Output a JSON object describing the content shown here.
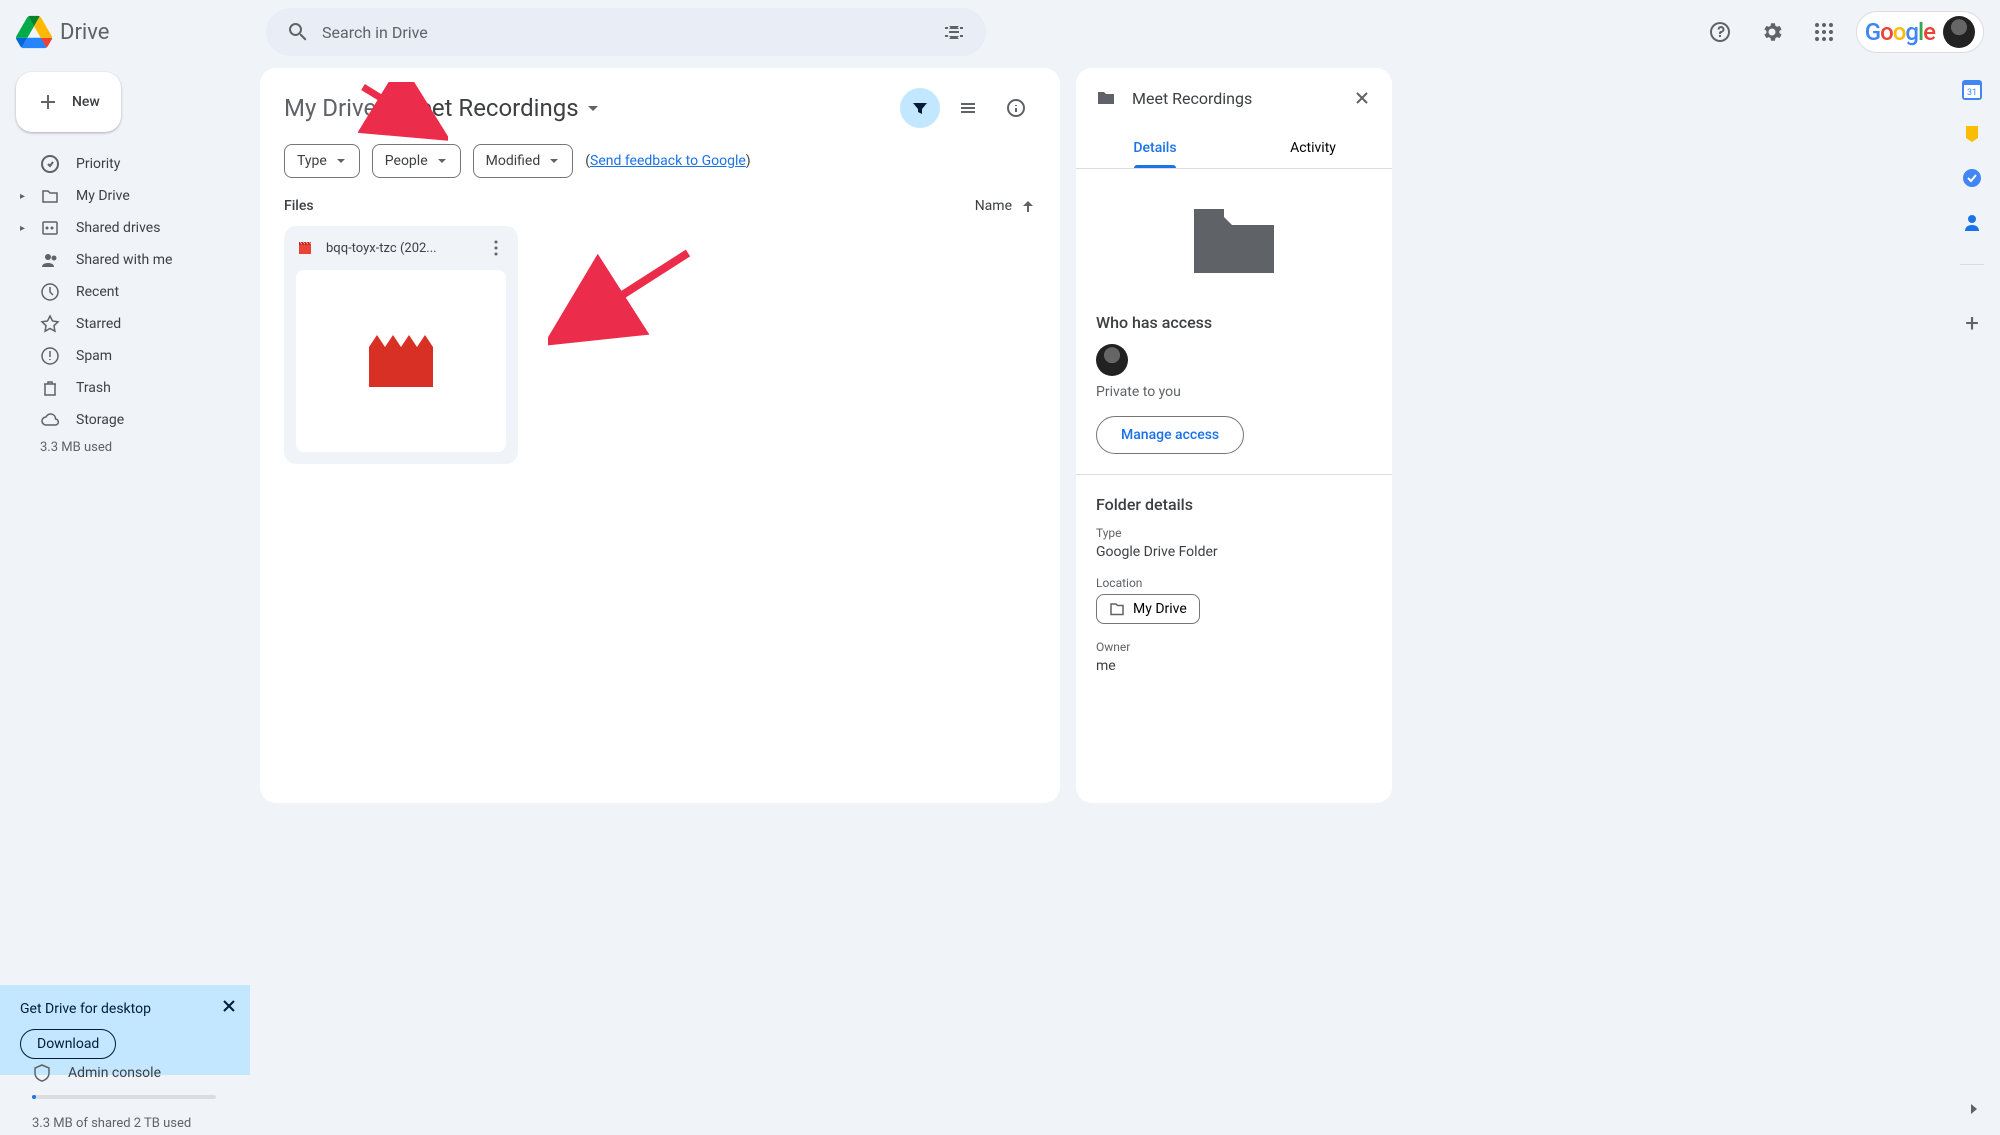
{
  "app": {
    "name": "Drive"
  },
  "search": {
    "placeholder": "Search in Drive"
  },
  "header": {
    "google_label": "Google"
  },
  "sidebar": {
    "new_label": "New",
    "items": [
      {
        "label": "Priority"
      },
      {
        "label": "My Drive"
      },
      {
        "label": "Shared drives"
      },
      {
        "label": "Shared with me"
      },
      {
        "label": "Recent"
      },
      {
        "label": "Starred"
      },
      {
        "label": "Spam"
      },
      {
        "label": "Trash"
      },
      {
        "label": "Storage"
      }
    ],
    "storage_used": "3.3 MB used",
    "promo": {
      "title": "Get Drive for desktop",
      "button": "Download"
    },
    "admin_label": "Admin console",
    "storage_summary": "3.3 MB of shared 2 TB used"
  },
  "breadcrumb": {
    "root": "My Drive",
    "current": "Meet Recordings"
  },
  "chips": {
    "type": "Type",
    "people": "People",
    "modified": "Modified"
  },
  "feedback": {
    "open": "(",
    "link": "Send feedback to Google",
    "close": ")"
  },
  "files": {
    "section_label": "Files",
    "sort_label": "Name",
    "items": [
      {
        "name": "bqq-toyx-tzc (202..."
      }
    ]
  },
  "details": {
    "title": "Meet Recordings",
    "tabs": {
      "details": "Details",
      "activity": "Activity"
    },
    "access": {
      "heading": "Who has access",
      "private": "Private to you",
      "manage": "Manage access"
    },
    "folder_details": {
      "heading": "Folder details",
      "type_label": "Type",
      "type_value": "Google Drive Folder",
      "location_label": "Location",
      "location_value": "My Drive",
      "owner_label": "Owner",
      "owner_value": "me"
    }
  }
}
